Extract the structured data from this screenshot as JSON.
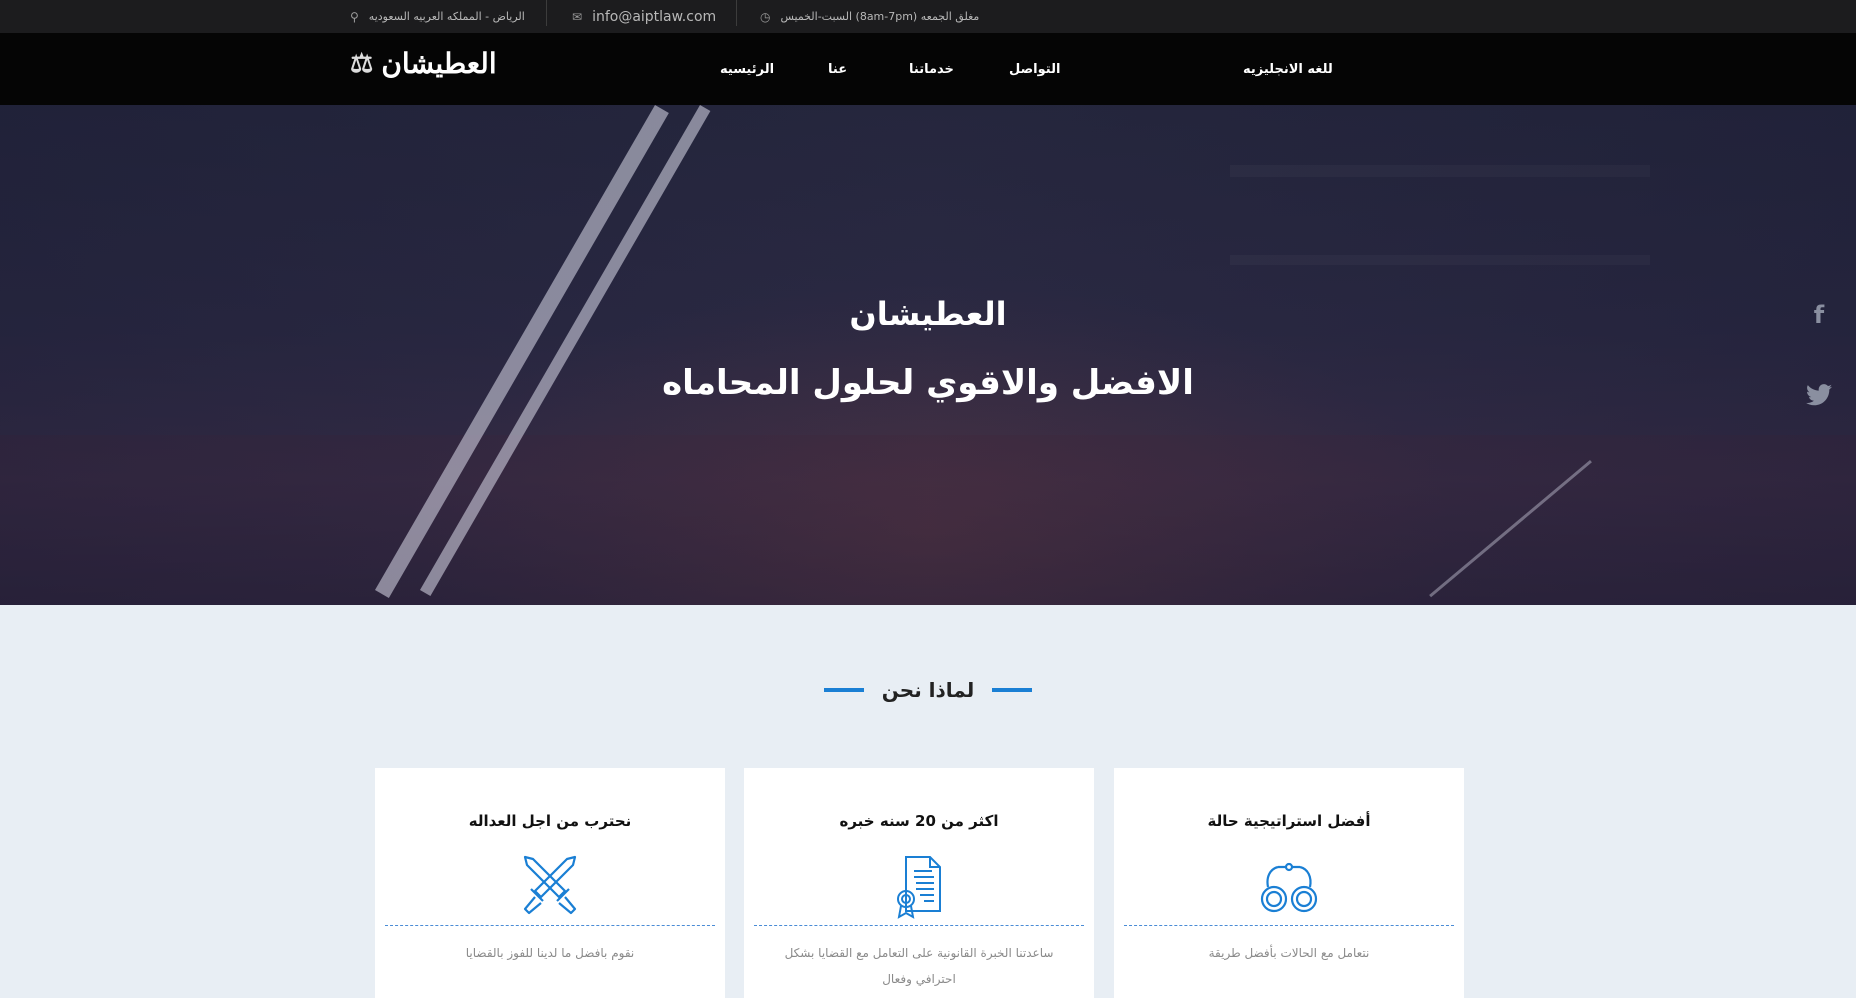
{
  "topbar": {
    "hours": "السبت-الخميس (8am-7pm) مغلق الجمعه",
    "email": "info@aiptlaw.com",
    "address": "الرياض - المملكه العربيه السعوديه"
  },
  "brand": {
    "logo_text": "العطيشان"
  },
  "nav": {
    "items": [
      {
        "label": "للغه الانجليزيه"
      },
      {
        "label": "التواصل"
      },
      {
        "label": "خدماتنا"
      },
      {
        "label": "عنا"
      },
      {
        "label": "الرئيسيه"
      }
    ]
  },
  "hero": {
    "line1": "العطيشان",
    "line2": "الافضل والاقوي لحلول المحاماه"
  },
  "social": {
    "facebook": "f",
    "twitter": "t"
  },
  "why_us": {
    "title": "لماذا نحن",
    "cards": [
      {
        "title": "أفضل استراتيجية حالة",
        "text": "نتعامل مع الحالات بأفضل طريقة",
        "icon": "handcuffs-icon"
      },
      {
        "title": "اكثر من 20 سنه خبره",
        "text": "ساعدتنا الخبرة القانونية على التعامل مع القضايا بشكل احترافي وفعال",
        "icon": "certificate-icon"
      },
      {
        "title": "نحترب من اجل العداله",
        "text": "نقوم بافضل ما لدينا للفوز بالقضايا",
        "icon": "crossed-swords-icon"
      }
    ]
  },
  "colors": {
    "accent": "#1a7fd4",
    "topbar_bg": "#1c1c1e",
    "nav_bg": "#050505",
    "section_bg": "#e8eef4"
  }
}
